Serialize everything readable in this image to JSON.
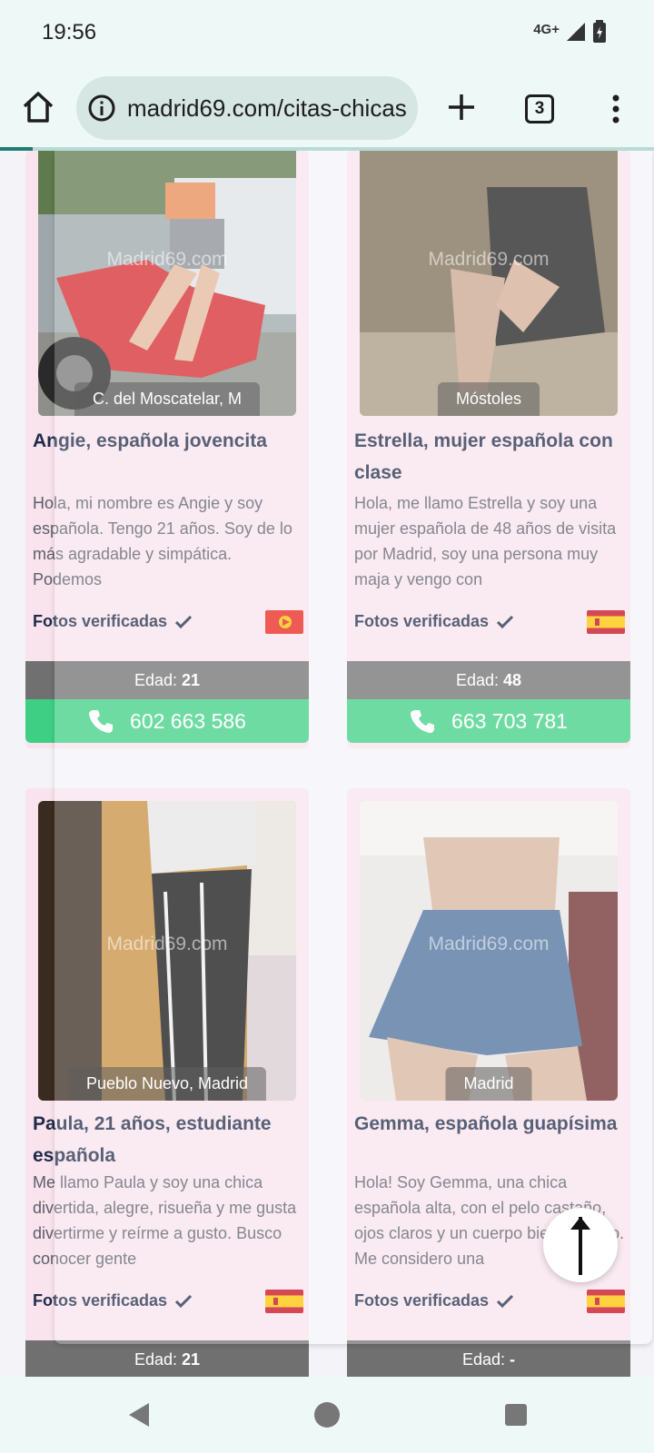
{
  "status_bar": {
    "time": "19:56",
    "network": "4G+"
  },
  "browser": {
    "url": "madrid69.com/citas-chicas",
    "tab_count": "3"
  },
  "cards": [
    {
      "location": "C. del Moscatelar, M",
      "title": "Angie, española jovencita",
      "description": "Hola, mi nombre es Angie y soy española. Tengo 21 años. Soy de lo más agradable y simpática. Podemos",
      "verified": "Fotos verificadas",
      "age_label": "Edad:",
      "age": "21",
      "phone": "602 663 586",
      "watermark": "Madrid69.com"
    },
    {
      "location": "Móstoles",
      "title": "Estrella, mujer española con clase",
      "description": "Hola, me llamo Estrella y soy una mujer española de 48 años de visita por Madrid, soy una persona muy maja y vengo con",
      "verified": "Fotos verificadas",
      "age_label": "Edad:",
      "age": "48",
      "phone": "663 703 781",
      "watermark": "Madrid69.com"
    },
    {
      "location": "Pueblo Nuevo, Madrid",
      "title": "Paula, 21 años, estudiante española",
      "description": "Me llamo Paula y soy una chica divertida, alegre, risueña y me gusta divertirme y reírme a gusto. Busco conocer gente",
      "verified": "Fotos verificadas",
      "age_label": "Edad:",
      "age": "21",
      "watermark": "Madrid69.com"
    },
    {
      "location": "Madrid",
      "title": "Gemma, española guapísima",
      "description": "Hola! Soy Gemma, una chica española alta, con el pelo castaño, ojos claros y un cuerpo bien cuidado. Me considero una",
      "verified": "Fotos verificadas",
      "age_label": "Edad:",
      "age": "-",
      "watermark": "Madrid69.com"
    }
  ],
  "colors": {
    "card_bg": "#f9e3ec",
    "phone_green": "#3ecf85",
    "age_gray": "#707070",
    "title_navy": "#1f2b4a"
  },
  "icons": [
    "home-icon",
    "info-icon",
    "plus-icon",
    "tabs-icon",
    "menu-icon",
    "phone-icon",
    "check-icon",
    "flag-spain-icon",
    "arrow-up-icon",
    "back-icon",
    "home-circle-icon",
    "recents-icon"
  ]
}
